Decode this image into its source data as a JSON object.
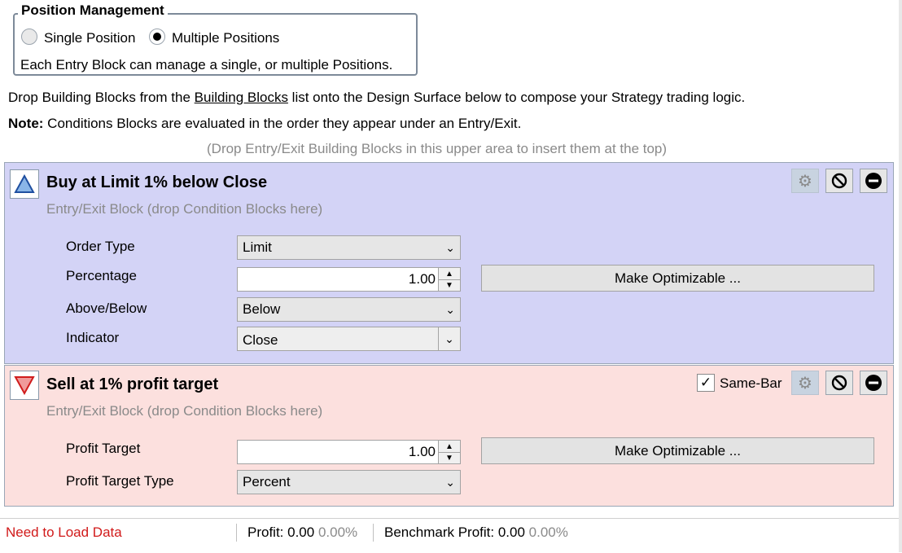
{
  "position_management": {
    "legend": "Position Management",
    "options": [
      {
        "label": "Single Position",
        "selected": false
      },
      {
        "label": "Multiple Positions",
        "selected": true
      }
    ],
    "description": "Each Entry Block can manage a single, or multiple Positions."
  },
  "instructions": {
    "line1_pre": "Drop Building Blocks from the ",
    "line1_link": "Building Blocks",
    "line1_post": " list onto the Design Surface below to compose your Strategy trading logic.",
    "note_label": "Note:",
    "note_text": " Conditions Blocks are evaluated in the order they appear under an Entry/Exit.",
    "drop_hint": "(Drop Entry/Exit Building Blocks in this upper area to insert them at the top)"
  },
  "buy_block": {
    "title": "Buy at Limit 1% below Close",
    "subtitle": "Entry/Exit Block (drop Condition Blocks here)",
    "bg_color": "#d3d3f6",
    "params": {
      "order_type_label": "Order Type",
      "order_type_value": "Limit",
      "percentage_label": "Percentage",
      "percentage_value": "1.00",
      "above_below_label": "Above/Below",
      "above_below_value": "Below",
      "indicator_label": "Indicator",
      "indicator_value": "Close"
    },
    "optimize_button": "Make Optimizable ..."
  },
  "sell_block": {
    "title": "Sell at 1% profit target",
    "subtitle": "Entry/Exit Block (drop Condition Blocks here)",
    "bg_color": "#fce0de",
    "same_bar_label": "Same-Bar",
    "same_bar_checked": true,
    "params": {
      "profit_target_label": "Profit Target",
      "profit_target_value": "1.00",
      "profit_target_type_label": "Profit Target Type",
      "profit_target_type_value": "Percent"
    },
    "optimize_button": "Make Optimizable ..."
  },
  "status_bar": {
    "status": "Need to Load Data",
    "profit_label": "Profit: 0.00",
    "profit_pct": "0.00%",
    "benchmark_label": "Benchmark Profit: 0.00",
    "benchmark_pct": "0.00%"
  },
  "icons": {
    "entry": "triangle-up-icon",
    "exit": "triangle-down-icon",
    "settings": "gear-icon",
    "disable": "ban-icon",
    "remove": "minus-circle-icon"
  }
}
